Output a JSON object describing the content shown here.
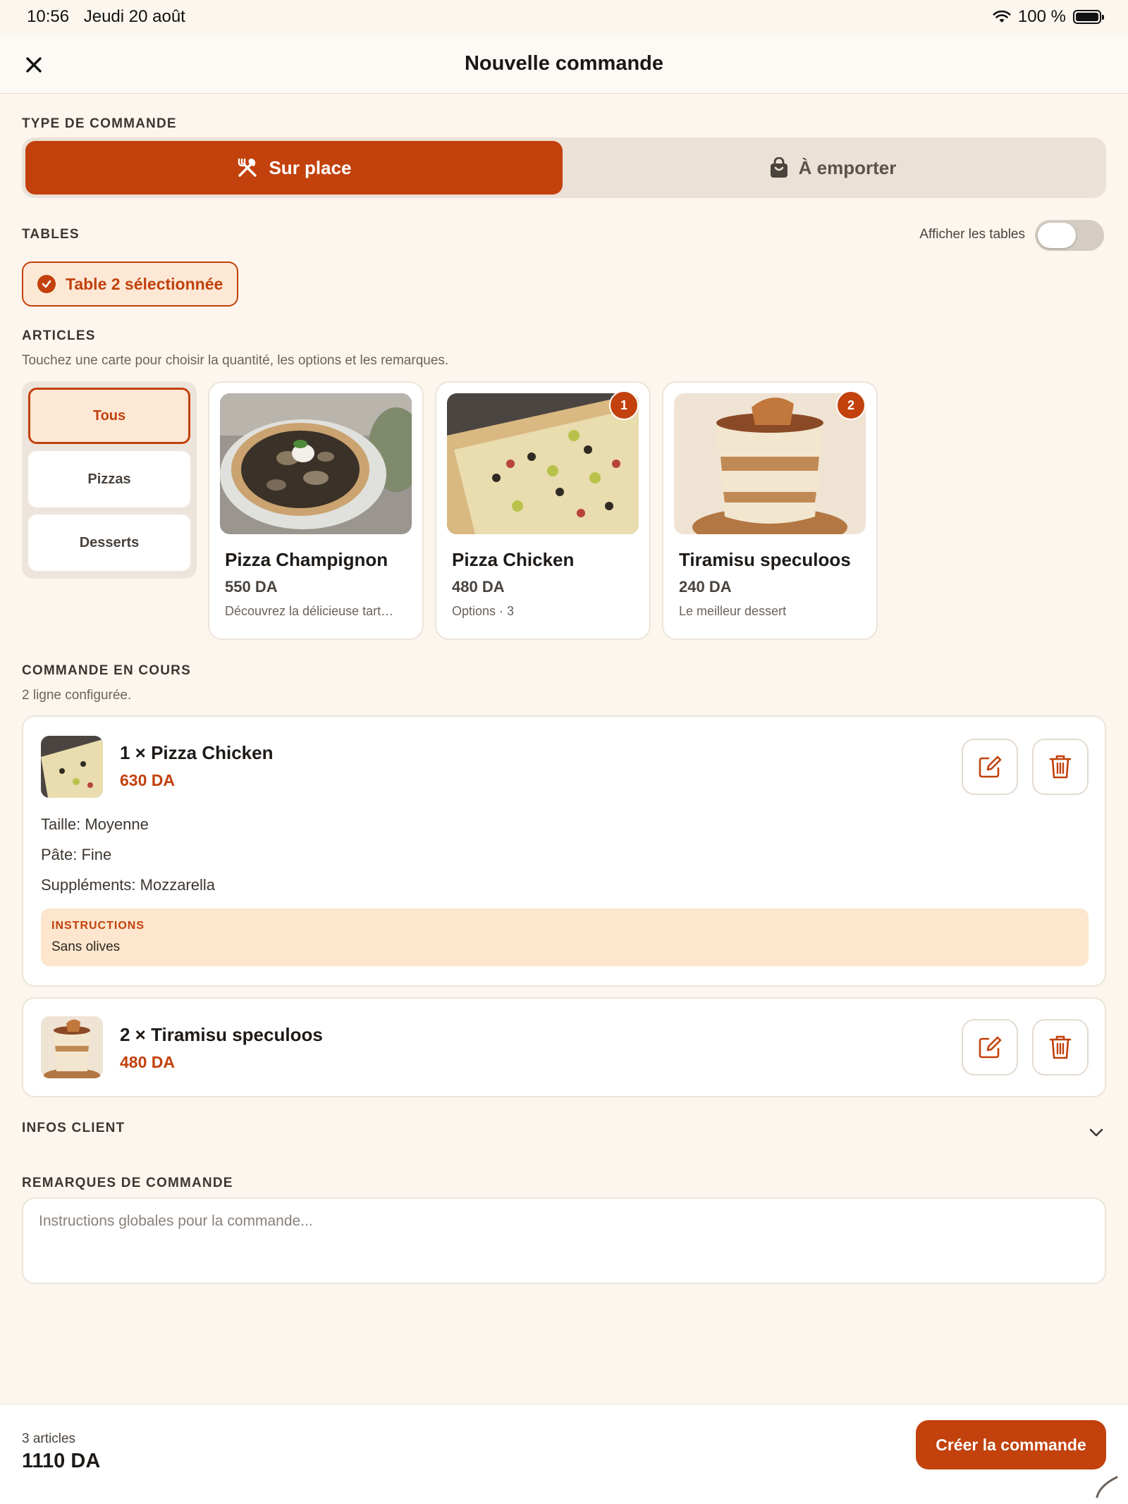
{
  "status_bar": {
    "time": "10:56",
    "date": "Jeudi 20 août",
    "battery": "100 %"
  },
  "header": {
    "title": "Nouvelle commande"
  },
  "order_type": {
    "label": "TYPE DE COMMANDE",
    "options": [
      {
        "label": "Sur place",
        "icon": "utensils-icon"
      },
      {
        "label": "À emporter",
        "icon": "shopping-bag-icon"
      }
    ],
    "selected": "Sur place"
  },
  "tables": {
    "label": "TABLES",
    "toggle_label": "Afficher les tables",
    "show_tables": false,
    "selected_chip": "Table 2 sélectionnée"
  },
  "articles": {
    "label": "ARTICLES",
    "hint": "Touchez une carte pour choisir la quantité, les options et les remarques.",
    "categories": [
      "Tous",
      "Pizzas",
      "Desserts"
    ],
    "selected_category": "Tous",
    "products": [
      {
        "name": "Pizza Champignon",
        "price": "550 DA",
        "desc": "Découvrez la délicieuse tart…",
        "badge": ""
      },
      {
        "name": "Pizza Chicken",
        "price": "480 DA",
        "desc": "Options · 3",
        "badge": "1"
      },
      {
        "name": "Tiramisu speculoos",
        "price": "240 DA",
        "desc": "Le meilleur dessert",
        "badge": "2"
      }
    ]
  },
  "current_order": {
    "label": "COMMANDE EN COURS",
    "subtitle": "2 ligne configurée.",
    "lines": [
      {
        "title": "1 × Pizza Chicken",
        "price": "630 DA",
        "details": [
          "Taille: Moyenne",
          "Pâte: Fine",
          "Suppléments: Mozzarella"
        ],
        "instructions_label": "INSTRUCTIONS",
        "instructions": "Sans olives"
      },
      {
        "title": "2 × Tiramisu speculoos",
        "price": "480 DA"
      }
    ]
  },
  "client_info": {
    "label": "INFOS CLIENT"
  },
  "remarks": {
    "label": "REMARQUES DE COMMANDE",
    "placeholder": "Instructions globales pour la commande...",
    "value": ""
  },
  "footer": {
    "count": "3 articles",
    "total": "1110 DA",
    "create_label": "Créer la commande"
  },
  "colors": {
    "accent": "#c2410c",
    "background": "#fcf6ef",
    "accent_soft": "#fde8d6"
  }
}
